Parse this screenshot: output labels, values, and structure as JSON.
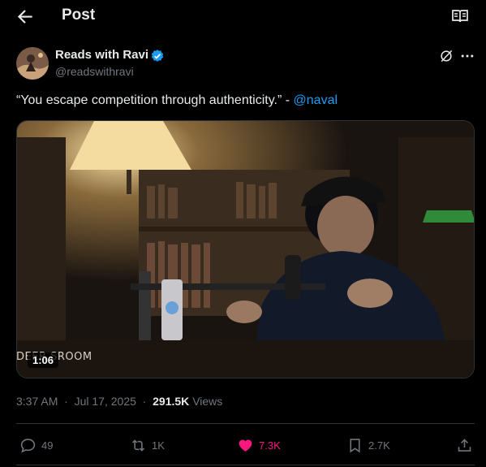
{
  "header": {
    "title": "Post"
  },
  "post": {
    "author_name": "Reads with Ravi",
    "handle": "@readswithravi",
    "text": "“You escape competition through authenticity.” - ",
    "mention": "@naval",
    "video": {
      "duration": "1:06",
      "watermark": "DEER SROOM"
    },
    "time": "3:37 AM",
    "date": "Jul 17, 2025",
    "views_count": "291.5K",
    "views_label": "Views"
  },
  "actions": {
    "replies": "49",
    "reposts": "1K",
    "likes": "7.3K",
    "bookmarks": "2.7K"
  },
  "colors": {
    "accent": "#1d9bf0",
    "like": "#f91880",
    "muted": "#71767b",
    "text": "#e7e9ea"
  }
}
